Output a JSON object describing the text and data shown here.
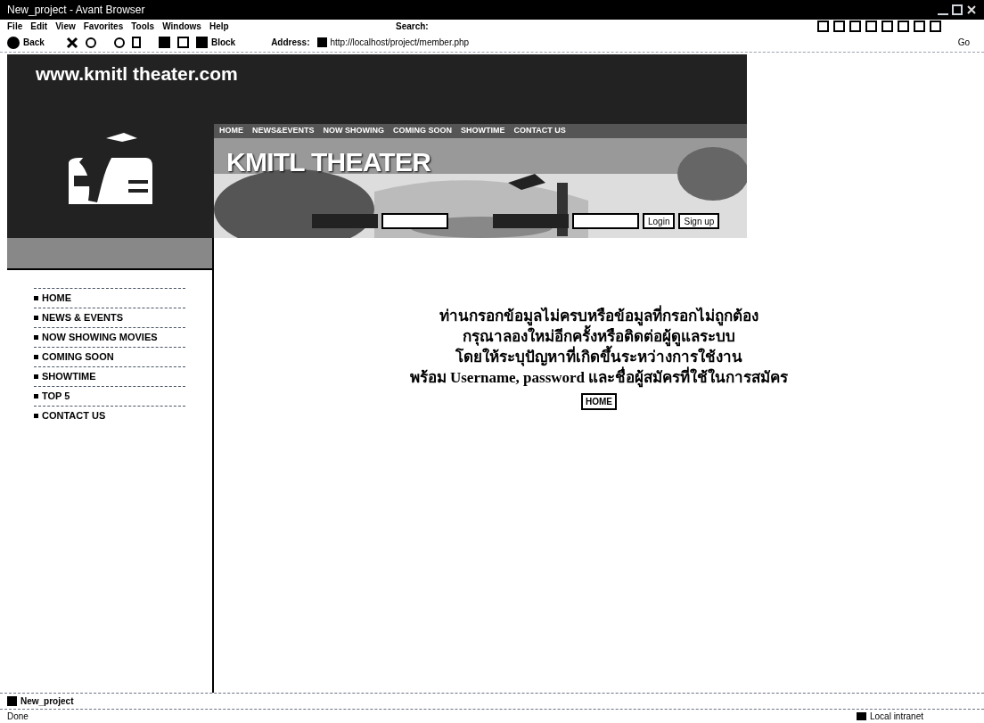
{
  "window": {
    "title": "New_project - Avant Browser"
  },
  "menu": [
    "File",
    "Edit",
    "View",
    "Favorites",
    "Tools",
    "Windows",
    "Help"
  ],
  "search": {
    "label": "Search:"
  },
  "toolbar": {
    "back": "Back",
    "block": "Block",
    "address_label": "Address:",
    "address": "http://localhost/project/member.php",
    "go": "Go"
  },
  "site": {
    "domain": "www.kmitl theater.com",
    "title": "KMITL THEATER",
    "nav": [
      "HOME",
      "NEWS&EVENTS",
      "NOW SHOWING",
      "COMING SOON",
      "SHOWTIME",
      "CONTACT US"
    ],
    "login_button": "Login",
    "signup_button": "Sign up",
    "sidebar": [
      "HOME",
      "NEWS & EVENTS",
      "NOW SHOWING MOVIES",
      "COMING SOON",
      "SHOWTIME",
      "TOP 5",
      "CONTACT US"
    ],
    "message": [
      "ท่านกรอกข้อมูลไม่ครบหรือข้อมูลที่กรอกไม่ถูกต้อง",
      "กรุณาลองใหม่อีกครั้งหรือติดต่อผู้ดูแลระบบ",
      "โดยให้ระบุปัญหาที่เกิดขึ้นระหว่างการใช้งาน",
      "พร้อม Username, password และชื่อผู้สมัครที่ใช้ในการสมัคร"
    ],
    "home_button": "HOME"
  },
  "tab": {
    "label": "New_project"
  },
  "status_bar": {
    "status": "Done",
    "zone": "Local intranet"
  }
}
